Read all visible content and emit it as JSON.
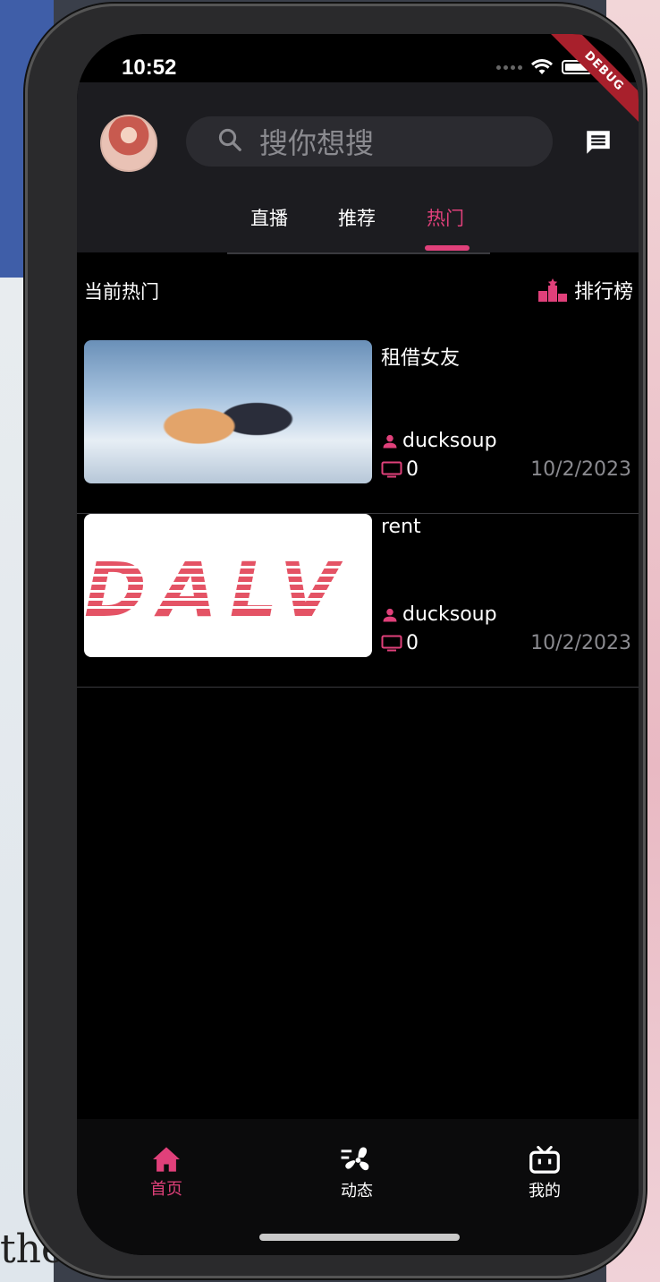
{
  "status_bar": {
    "time": "10:52",
    "debug_label": "DEBUG"
  },
  "header": {
    "search_placeholder": "搜你想搜",
    "tabs": [
      {
        "label": "直播",
        "active": false
      },
      {
        "label": "推荐",
        "active": false
      },
      {
        "label": "热门",
        "active": true
      }
    ]
  },
  "section": {
    "title": "当前热门",
    "ranking_label": "排行榜"
  },
  "videos": [
    {
      "title": "租借女友",
      "author": "ducksoup",
      "views": "0",
      "date": "10/2/2023",
      "thumbnail": "anime-thumbnail"
    },
    {
      "title": "rent",
      "author": "ducksoup",
      "views": "0",
      "date": "10/2/2023",
      "thumbnail": "logo-thumbnail",
      "thumbnail_text": "DALV"
    }
  ],
  "bottom_nav": [
    {
      "label": "首页",
      "icon": "home-icon",
      "active": true
    },
    {
      "label": "动态",
      "icon": "fan-icon",
      "active": false
    },
    {
      "label": "我的",
      "icon": "tv-face-icon",
      "active": false
    }
  ],
  "colors": {
    "accent": "#e0407a",
    "background": "#000000",
    "header": "#1c1c20"
  },
  "backdrop_text": "the"
}
